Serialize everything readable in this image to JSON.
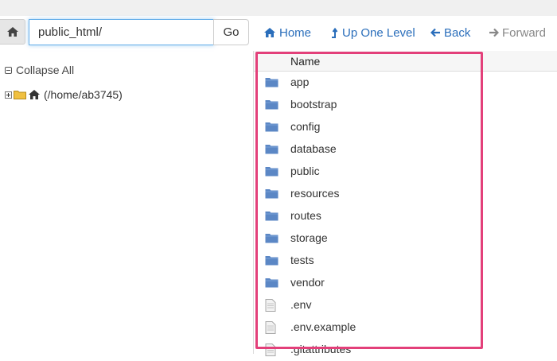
{
  "toolbar": {
    "path_value": "public_html/",
    "go_label": "Go",
    "home_label": "Home",
    "up_label": "Up One Level",
    "back_label": "Back",
    "forward_label": "Forward"
  },
  "tree": {
    "collapse_all_label": "Collapse All",
    "root_label": "(/home/ab3745)"
  },
  "list": {
    "column_header": "Name",
    "items": [
      {
        "name": "app",
        "type": "folder"
      },
      {
        "name": "bootstrap",
        "type": "folder"
      },
      {
        "name": "config",
        "type": "folder"
      },
      {
        "name": "database",
        "type": "folder"
      },
      {
        "name": "public",
        "type": "folder"
      },
      {
        "name": "resources",
        "type": "folder"
      },
      {
        "name": "routes",
        "type": "folder"
      },
      {
        "name": "storage",
        "type": "folder"
      },
      {
        "name": "tests",
        "type": "folder"
      },
      {
        "name": "vendor",
        "type": "folder"
      },
      {
        "name": ".env",
        "type": "file"
      },
      {
        "name": ".env.example",
        "type": "file"
      },
      {
        "name": ".gitattributes",
        "type": "file"
      }
    ]
  },
  "colors": {
    "link": "#2a6ebb",
    "folder": "#5b87c5",
    "highlight": "#e3407a",
    "input_focus": "#66afe9"
  }
}
